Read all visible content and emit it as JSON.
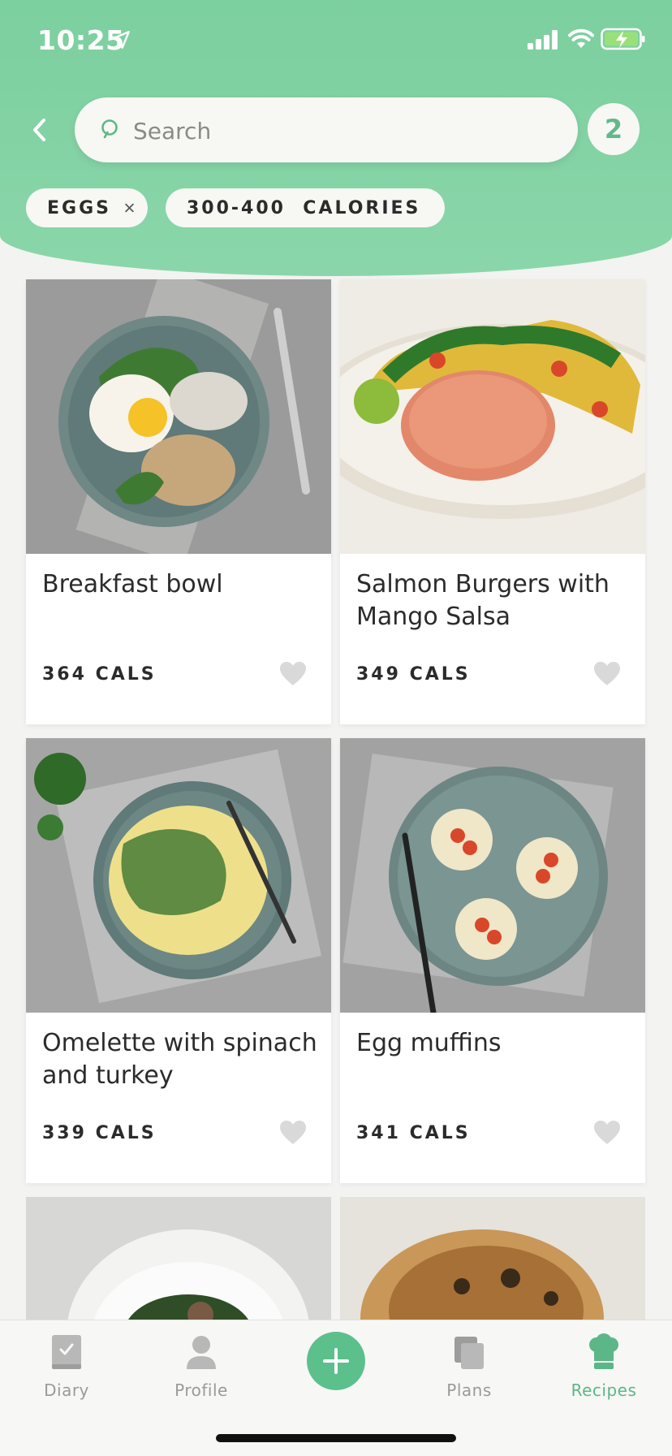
{
  "status_bar": {
    "time": "10:25"
  },
  "search": {
    "placeholder": "Search",
    "filter_count": "2"
  },
  "filters": [
    {
      "label": "EGGS"
    },
    {
      "label": "300-400  CALORIES"
    }
  ],
  "recipes": [
    {
      "title": "Breakfast bowl",
      "cals": "364 CALS"
    },
    {
      "title": "Salmon Burgers with Mango Salsa",
      "cals": "349 CALS"
    },
    {
      "title": "Omelette with spinach and turkey",
      "cals": "339 CALS"
    },
    {
      "title": "Egg muffins",
      "cals": "341 CALS"
    }
  ],
  "tabs": [
    {
      "label": "Diary",
      "icon": "diary-icon"
    },
    {
      "label": "Profile",
      "icon": "profile-icon"
    },
    {
      "label": "Plans",
      "icon": "plans-icon"
    },
    {
      "label": "Recipes",
      "icon": "recipes-chef-hat-icon",
      "active": true
    }
  ],
  "colors": {
    "accent": "#5cc08d",
    "header": "#84d3a6",
    "text": "#2b2b2b"
  }
}
